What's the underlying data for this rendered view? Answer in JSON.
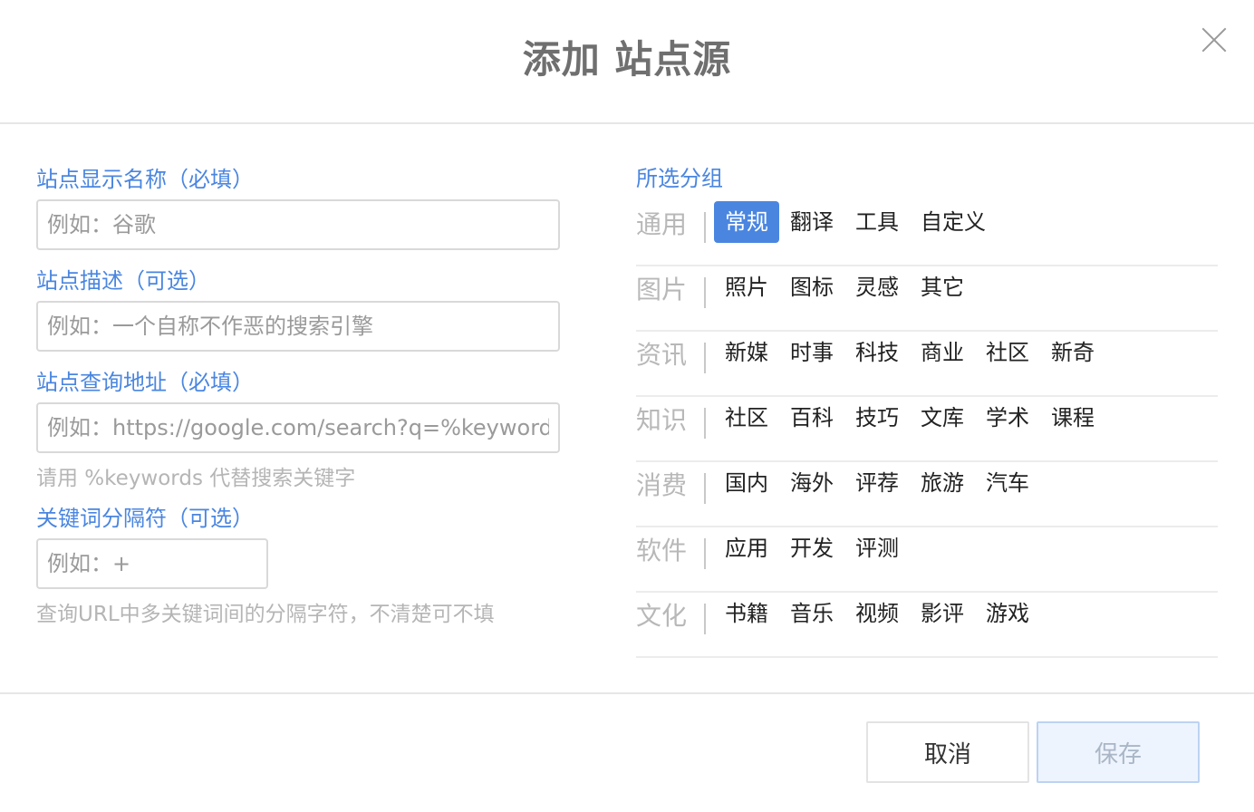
{
  "dialog": {
    "title": "添加 站点源",
    "close_icon": "close-icon"
  },
  "form": {
    "name_label": "站点显示名称（必填）",
    "name_placeholder": "例如：谷歌",
    "desc_label": "站点描述（可选）",
    "desc_placeholder": "例如：一个自称不作恶的搜索引擎",
    "url_label": "站点查询地址（必填）",
    "url_placeholder": "例如：https://google.com/search?q=%keywords",
    "url_hint": "请用 %keywords 代替搜索关键字",
    "sep_label": "关键词分隔符（可选）",
    "sep_placeholder": "例如：+",
    "sep_hint": "查询URL中多关键词间的分隔字符，不清楚可不填"
  },
  "groups": {
    "title": "所选分组",
    "categories": [
      {
        "name": "通用",
        "tags": [
          "常规",
          "翻译",
          "工具",
          "自定义"
        ]
      },
      {
        "name": "图片",
        "tags": [
          "照片",
          "图标",
          "灵感",
          "其它"
        ]
      },
      {
        "name": "资讯",
        "tags": [
          "新媒",
          "时事",
          "科技",
          "商业",
          "社区",
          "新奇"
        ]
      },
      {
        "name": "知识",
        "tags": [
          "社区",
          "百科",
          "技巧",
          "文库",
          "学术",
          "课程"
        ]
      },
      {
        "name": "消费",
        "tags": [
          "国内",
          "海外",
          "评荐",
          "旅游",
          "汽车"
        ]
      },
      {
        "name": "软件",
        "tags": [
          "应用",
          "开发",
          "评测"
        ]
      },
      {
        "name": "文化",
        "tags": [
          "书籍",
          "音乐",
          "视频",
          "影评",
          "游戏"
        ]
      }
    ],
    "selected": "常规",
    "accent_color": "#4a86e0"
  },
  "footer": {
    "cancel_label": "取消",
    "save_label": "保存"
  }
}
